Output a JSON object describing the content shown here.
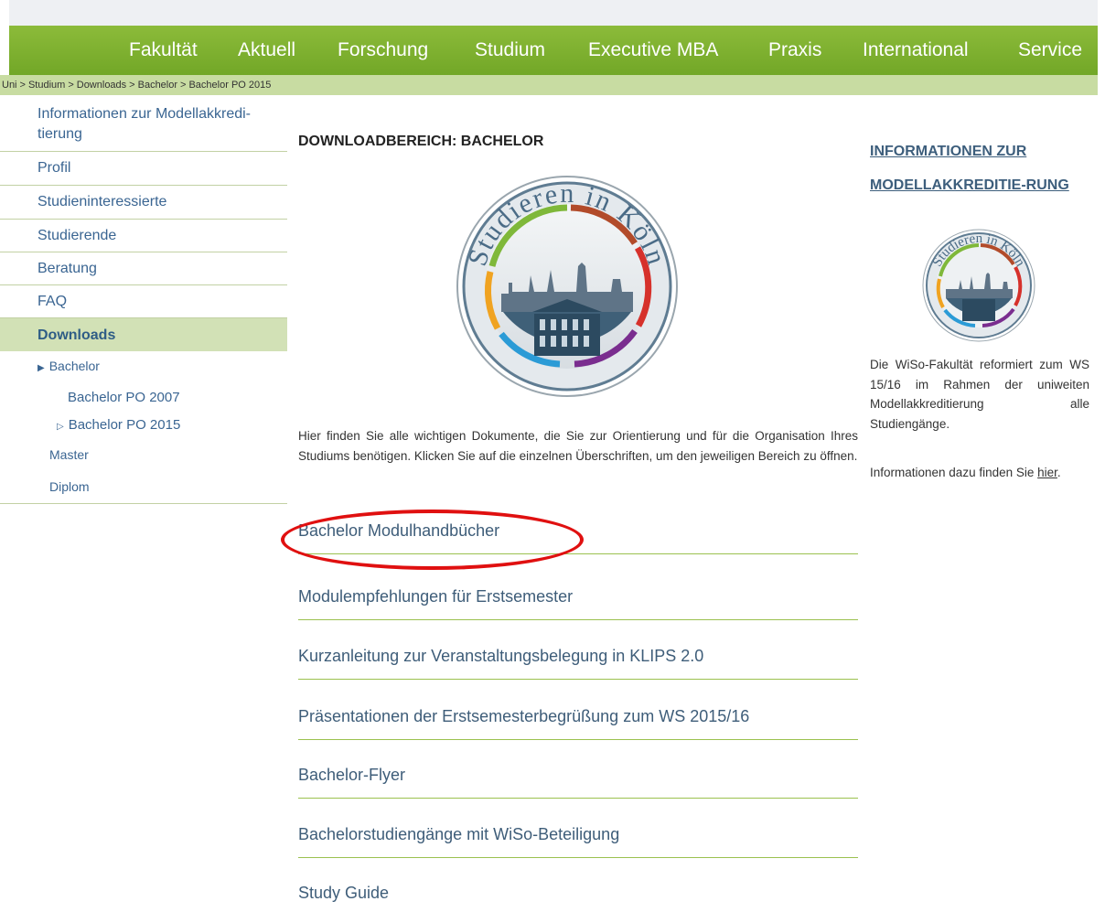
{
  "nav": {
    "items": [
      "Fakultät",
      "Aktuell",
      "Forschung",
      "Studium",
      "Executive MBA",
      "Praxis",
      "International",
      "Service"
    ]
  },
  "breadcrumb": [
    "Uni",
    "Studium",
    "Downloads",
    "Bachelor",
    "Bachelor PO 2015"
  ],
  "breadcrumb_separator": ">",
  "sidebar": {
    "items": [
      "Informationen zur Modellakkredi-tierung",
      "Profil",
      "Studieninteressierte",
      "Studierende",
      "Beratung",
      "FAQ",
      "Downloads"
    ],
    "sub_items": {
      "bachelor": "Bachelor",
      "bachelor_po_2007": "Bachelor PO 2007",
      "bachelor_po_2015": "Bachelor PO 2015",
      "master": "Master",
      "diplom": "Diplom"
    }
  },
  "main": {
    "title": "DOWNLOADBEREICH: BACHELOR",
    "logo_text": "Studieren in Köln",
    "intro": "Hier finden Sie alle wichtigen Dokumente, die Sie zur Orientierung und für die Organisation Ihres Studiums benötigen. Klicken Sie auf die einzelnen Überschriften, um den jeweiligen Bereich zu öffnen.",
    "downloads": [
      "Bachelor Modulhandbücher",
      "Modulempfehlungen für Erstsemester",
      "Kurzanleitung zur Veranstaltungsbelegung in KLIPS 2.0",
      "Präsentationen der Erstsemesterbegrüßung zum WS 2015/16",
      "Bachelor-Flyer",
      "Bachelorstudiengänge mit WiSo-Beteiligung",
      "Study Guide"
    ]
  },
  "right": {
    "title": "INFORMATIONEN ZUR MODELLAKKREDITIE-RUNG",
    "logo_text": "Studieren in Köln",
    "text1": "Die WiSo-Fakultät reformiert zum WS 15/16 im Rahmen der uniweiten Modellakkreditierung alle Studiengänge.",
    "text2_prefix": "Informationen dazu finden Sie ",
    "text2_link": "hier",
    "text2_suffix": "."
  },
  "colors": {
    "nav_green": "#7cb030",
    "breadcrumb_bg": "#c8dca2",
    "active_bg": "#d2e1b6",
    "link_blue": "#3a6592",
    "highlight_red": "#e01010"
  }
}
